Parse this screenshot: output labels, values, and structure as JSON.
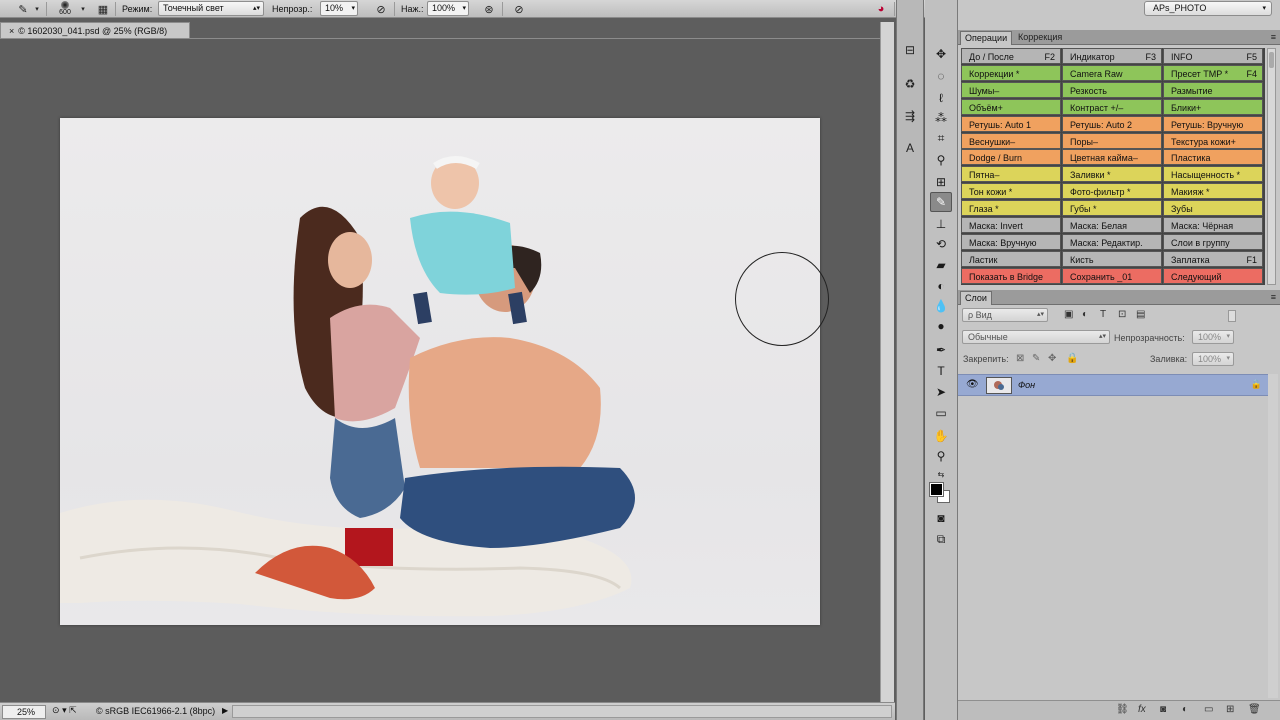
{
  "options_bar": {
    "brush_size": "600",
    "mode_label": "Режим:",
    "mode_value": "Точечный свет",
    "opacity_label": "Непрозр.:",
    "opacity_value": "10%",
    "pressure_label": "Наж.:",
    "pressure_value": "100%"
  },
  "workspace": {
    "value": "APs_PHOTO"
  },
  "document": {
    "tab_title": "© 1602030_041.psd @ 25% (RGB/8)",
    "close": "×"
  },
  "status_bar": {
    "zoom": "25%",
    "profile": "© sRGB IEC61966-2.1 (8bpc)"
  },
  "actions_panel": {
    "tabs": [
      "Операции",
      "Коррекция"
    ],
    "buttons": [
      [
        "До / После",
        "F2",
        "gray"
      ],
      [
        "Индикатор",
        "F3",
        "gray"
      ],
      [
        "INFO",
        "F5",
        "gray"
      ],
      [
        "Коррекции *",
        "",
        "green"
      ],
      [
        "Camera Raw",
        "",
        "green"
      ],
      [
        "Пресет TMP *",
        "F4",
        "green"
      ],
      [
        "Шумы–",
        "",
        "green"
      ],
      [
        "Резкость",
        "",
        "green"
      ],
      [
        "Размытие",
        "",
        "green"
      ],
      [
        "Объём+",
        "",
        "green"
      ],
      [
        "Контраст +/–",
        "",
        "green"
      ],
      [
        "Блики+",
        "",
        "green"
      ],
      [
        "Ретушь: Auto 1",
        "",
        "orange"
      ],
      [
        "Ретушь: Auto 2",
        "",
        "orange"
      ],
      [
        "Ретушь: Вручную",
        "",
        "orange"
      ],
      [
        "Веснушки–",
        "",
        "orange"
      ],
      [
        "Поры–",
        "",
        "orange"
      ],
      [
        "Текстура кожи+",
        "",
        "orange"
      ],
      [
        "Dodge / Burn",
        "",
        "orange"
      ],
      [
        "Цветная кайма–",
        "",
        "orange"
      ],
      [
        "Пластика",
        "",
        "orange"
      ],
      [
        "Пятна–",
        "",
        "yellow"
      ],
      [
        "Заливки *",
        "",
        "yellow"
      ],
      [
        "Насыщенность *",
        "",
        "yellow"
      ],
      [
        "Тон кожи *",
        "",
        "yellow"
      ],
      [
        "Фото-фильтр *",
        "",
        "yellow"
      ],
      [
        "Макияж *",
        "",
        "yellow"
      ],
      [
        "Глаза *",
        "",
        "yellow"
      ],
      [
        "Губы *",
        "",
        "yellow"
      ],
      [
        "Зубы",
        "",
        "yellow"
      ],
      [
        "Маска: Invert",
        "",
        "gray"
      ],
      [
        "Маска: Белая",
        "",
        "gray"
      ],
      [
        "Маска: Чёрная",
        "",
        "gray"
      ],
      [
        "Маска: Вручную",
        "",
        "gray"
      ],
      [
        "Маска: Редактир.",
        "",
        "gray"
      ],
      [
        "Слои в группу",
        "",
        "gray"
      ],
      [
        "Ластик",
        "",
        "gray"
      ],
      [
        "Кисть",
        "",
        "gray"
      ],
      [
        "Заплатка",
        "F1",
        "gray"
      ],
      [
        "Показать в Bridge",
        "",
        "red"
      ],
      [
        "Сохранить _01",
        "",
        "red"
      ],
      [
        "Следующий",
        "",
        "red"
      ]
    ]
  },
  "layers_panel": {
    "tab": "Слои",
    "filter_value": "ρ Вид",
    "blend_mode": "Обычные",
    "opacity_label": "Непрозрачность:",
    "opacity_value": "100%",
    "lock_label": "Закрепить:",
    "fill_label": "Заливка:",
    "fill_value": "100%",
    "layer_name": "Фон"
  }
}
